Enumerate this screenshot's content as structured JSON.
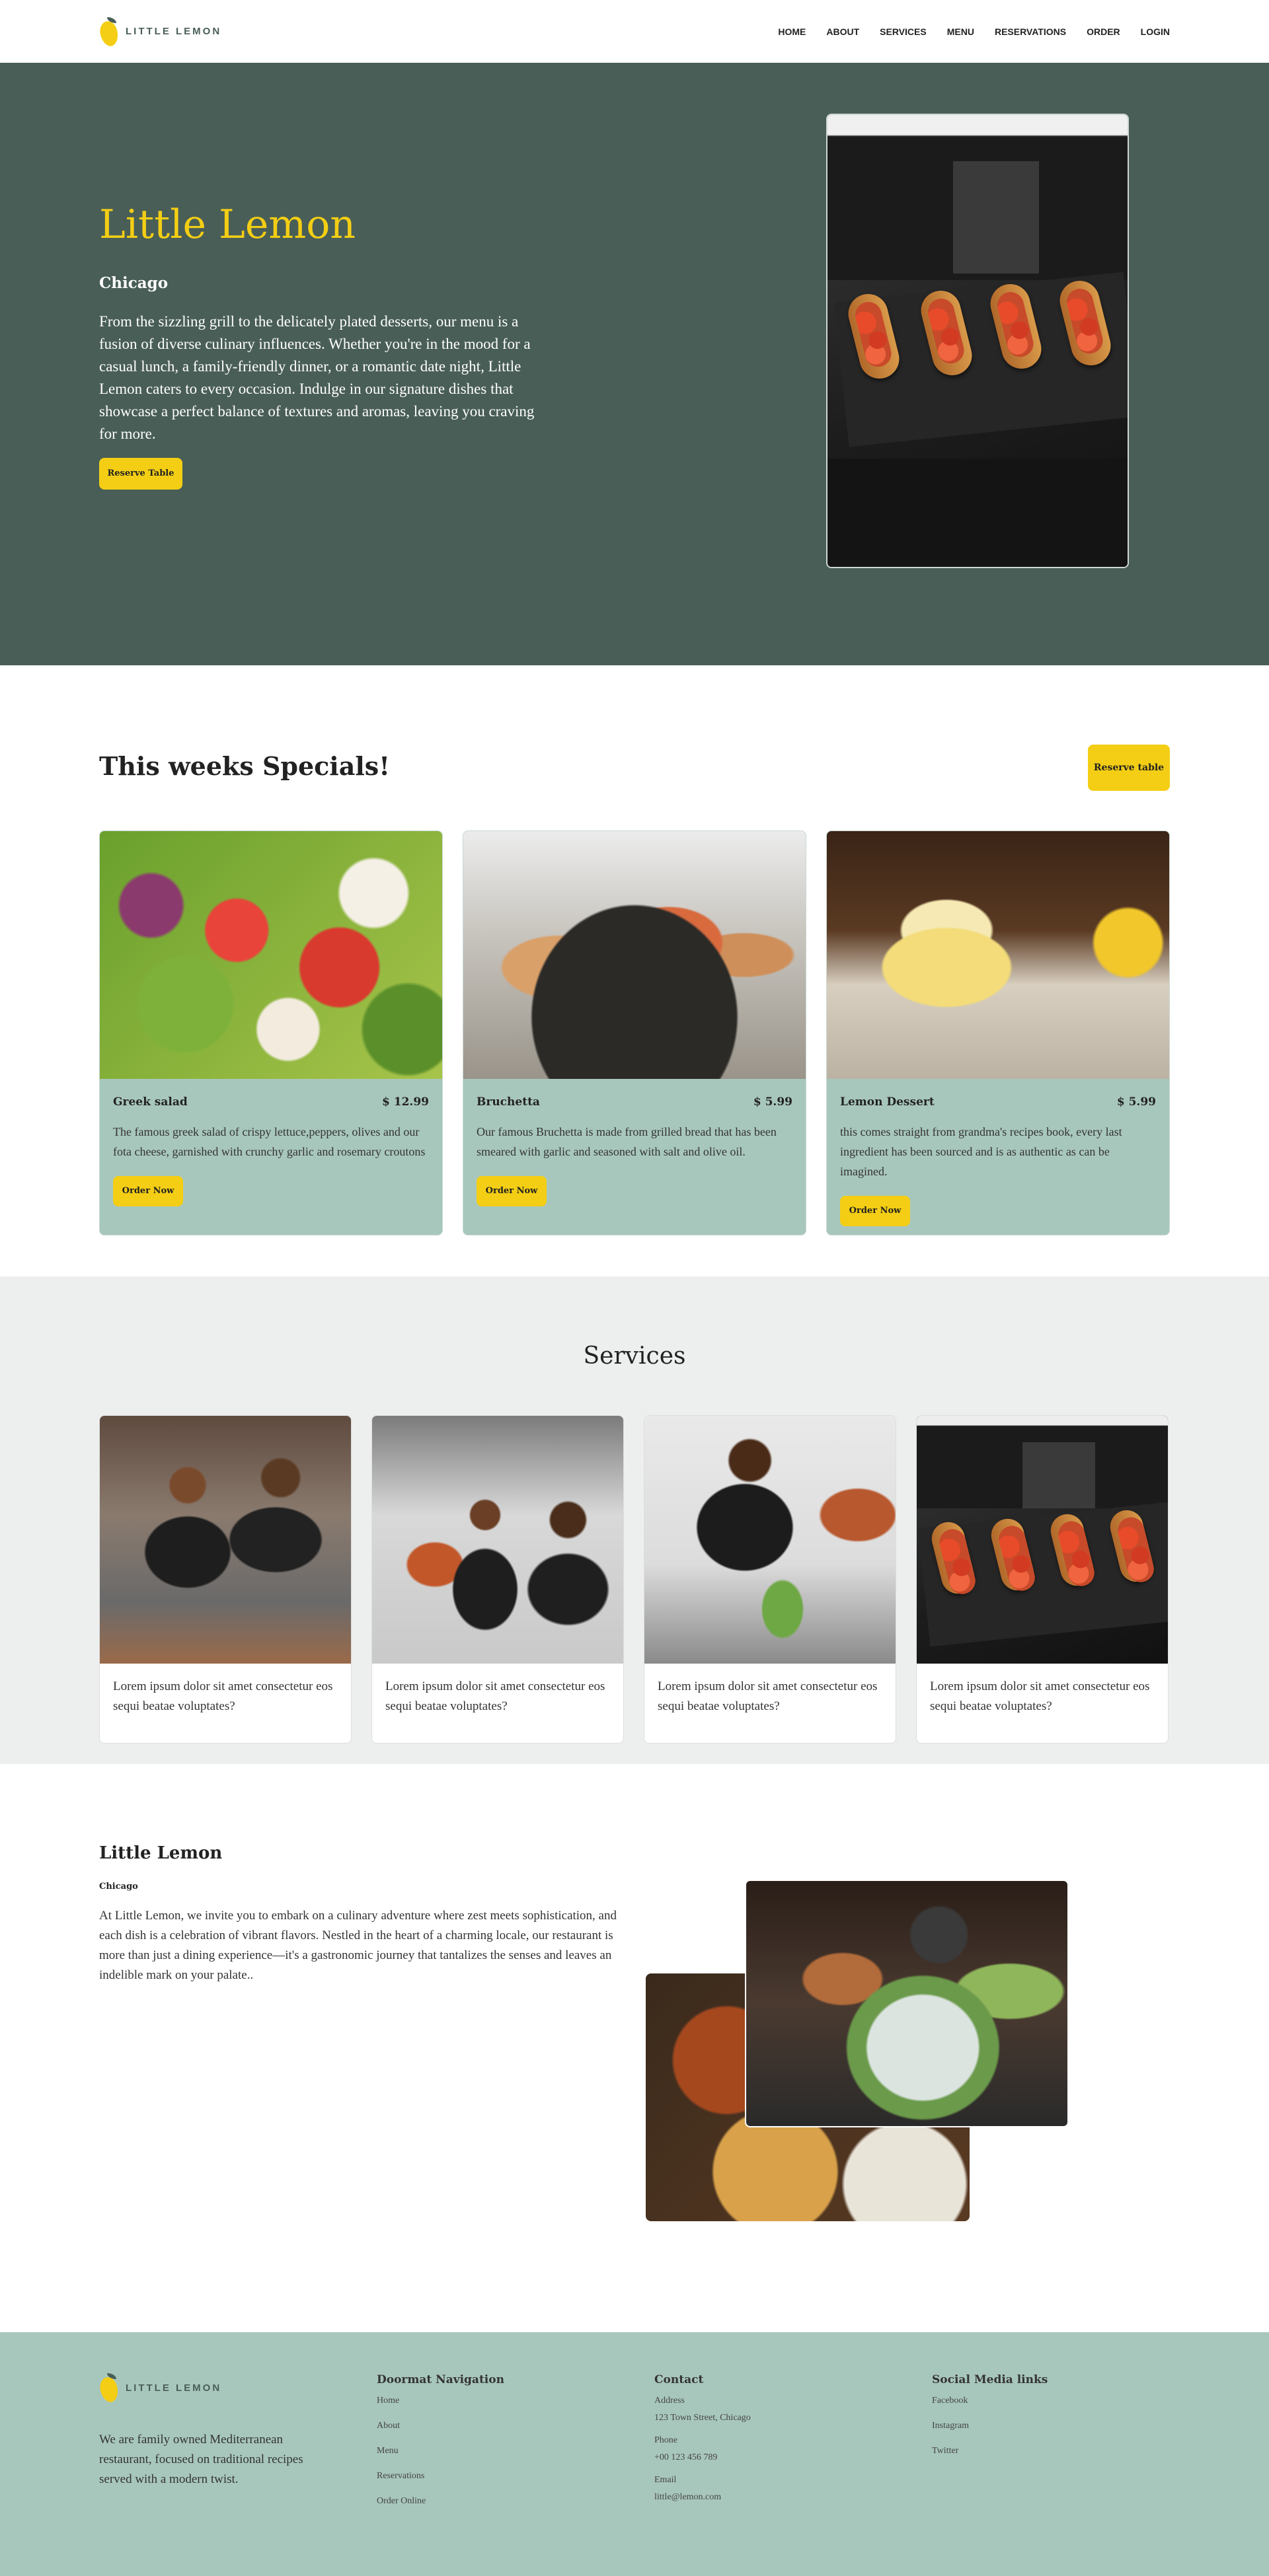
{
  "header": {
    "logo_text": "LITTLE LEMON",
    "nav": [
      "HOME",
      "ABOUT",
      "SERVICES",
      "MENU",
      "RESERVATIONS",
      "ORDER",
      "LOGIN"
    ]
  },
  "hero": {
    "title": "Little Lemon",
    "city": "Chicago",
    "description": "From the sizzling grill to the delicately plated desserts, our menu is a fusion of diverse culinary influences. Whether you're in the mood for a casual lunch, a family-friendly dinner, or a romantic date night, Little Lemon caters to every occasion. Indulge in our signature dishes that showcase a perfect balance of textures and aromas, leaving you craving for more.",
    "button": "Reserve Table"
  },
  "specials": {
    "title": "This weeks Specials!",
    "button": "Reserve table",
    "items": [
      {
        "name": "Greek salad",
        "price": "$ 12.99",
        "description": "The famous greek salad of crispy lettuce,peppers, olives and our fota cheese, garnished with crunchy garlic and rosemary croutons",
        "button": "Order Now"
      },
      {
        "name": "Bruchetta",
        "price": "$ 5.99",
        "description": "Our famous Bruchetta is made from grilled bread that has been smeared with garlic and seasoned with salt and olive oil.",
        "button": "Order Now"
      },
      {
        "name": "Lemon Dessert",
        "price": "$ 5.99",
        "description": "this comes straight from grandma's recipes book, every last ingredient has been sourced and is as authentic as can be imagined.",
        "button": "Order Now"
      }
    ]
  },
  "services": {
    "title": "Services",
    "items": [
      {
        "text": "Lorem ipsum dolor sit amet consectetur eos sequi beatae voluptates?"
      },
      {
        "text": "Lorem ipsum dolor sit amet consectetur eos sequi beatae voluptates?"
      },
      {
        "text": "Lorem ipsum dolor sit amet consectetur eos sequi beatae voluptates?"
      },
      {
        "text": "Lorem ipsum dolor sit amet consectetur eos sequi beatae voluptates?"
      }
    ]
  },
  "about": {
    "title": "Little Lemon",
    "city": "Chicago",
    "description": "At Little Lemon, we invite you to embark on a culinary adventure where zest meets sophistication, and each dish is a celebration of vibrant flavors. Nestled in the heart of a charming locale, our restaurant is more than just a dining experience—it's a gastronomic journey that tantalizes the senses and leaves an indelible mark on your palate.."
  },
  "footer": {
    "logo_text": "LITTLE LEMON",
    "tagline": "We are family owned Mediterranean restaurant, focused on traditional recipes served with a modern twist.",
    "nav_title": "Doormat Navigation",
    "nav_links": [
      "Home",
      "About",
      "Menu",
      "Reservations",
      "Order Online"
    ],
    "contact_title": "Contact",
    "address_label": "Address",
    "address": "123 Town Street, Chicago",
    "phone_label": "Phone",
    "phone": "+00 123 456 789",
    "email_label": "Email",
    "email": "little@lemon.com",
    "social_title": "Social Media links",
    "social_links": [
      "Facebook",
      "Instagram",
      "Twitter"
    ]
  },
  "colors": {
    "primary_green": "#495E57",
    "primary_yellow": "#F4CE14",
    "card_green": "#A8C7BC",
    "light_gray": "#EDEFEE"
  }
}
